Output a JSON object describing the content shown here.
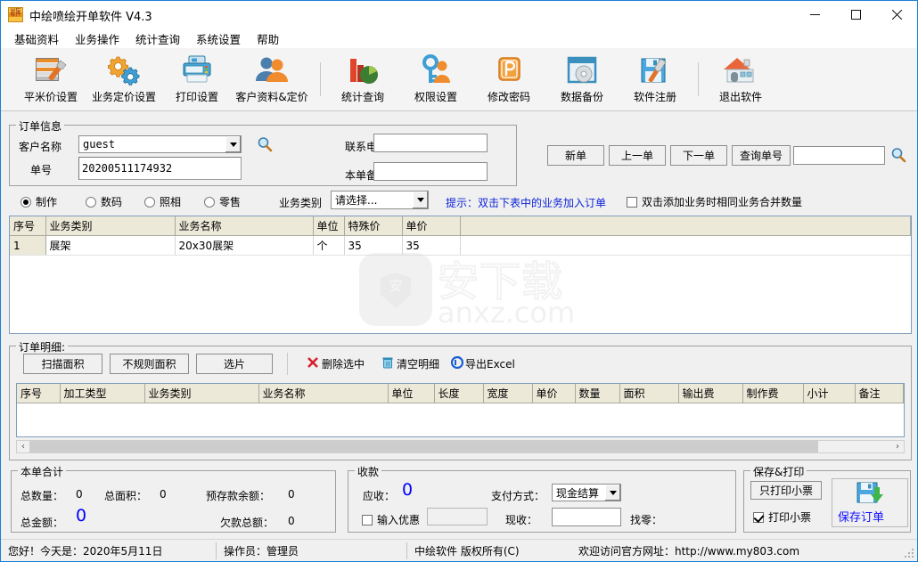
{
  "window": {
    "title": "中绘喷绘开单软件 V4.3",
    "icon": "app-icon",
    "controls": {
      "minimize": "minimize-icon",
      "maximize": "maximize-icon",
      "close": "close-icon"
    }
  },
  "menu": {
    "items": [
      "基础资料",
      "业务操作",
      "统计查询",
      "系统设置",
      "帮助"
    ]
  },
  "toolbar": {
    "items": [
      {
        "label": "平米价设置",
        "icon": "price-settings-icon"
      },
      {
        "label": "业务定价设置",
        "icon": "gears-icon"
      },
      {
        "label": "打印设置",
        "icon": "printer-icon"
      },
      {
        "label": "客户资料&定价",
        "icon": "users-icon"
      },
      {
        "label": "统计查询",
        "icon": "chart-icon"
      },
      {
        "label": "权限设置",
        "icon": "key-user-icon"
      },
      {
        "label": "修改密码",
        "icon": "password-icon"
      },
      {
        "label": "数据备份",
        "icon": "backup-disc-icon"
      },
      {
        "label": "软件注册",
        "icon": "register-floppy-icon"
      },
      {
        "label": "退出软件",
        "icon": "exit-house-icon"
      }
    ]
  },
  "order_info": {
    "legend": "订单信息",
    "customer_label": "客户名称",
    "customer_value": "guest",
    "customer_search_icon": "magnifier-icon",
    "order_no_label": "单号",
    "order_no_value": "20200511174932",
    "phone_label": "联系电话",
    "phone_value": "",
    "remark_label": "本单备注",
    "remark_value": ""
  },
  "nav": {
    "new_order": "新单",
    "prev_order": "上一单",
    "next_order": "下一单",
    "query_order": "查询单号",
    "query_value": "",
    "query_search_icon": "magnifier-icon"
  },
  "type_row": {
    "radios": [
      {
        "label": "制作",
        "checked": true
      },
      {
        "label": "数码",
        "checked": false
      },
      {
        "label": "照相",
        "checked": false
      },
      {
        "label": "零售",
        "checked": false
      }
    ],
    "category_label": "业务类别",
    "category_value": "请选择...",
    "hint": "提示：双击下表中的业务加入订单",
    "merge_checkbox": {
      "label": "双击添加业务时相同业务合并数量",
      "checked": false
    }
  },
  "biz_table": {
    "columns": [
      "序号",
      "业务类别",
      "业务名称",
      "单位",
      "特殊价",
      "单价"
    ],
    "rows": [
      {
        "序号": "1",
        "业务类别": "展架",
        "业务名称": "20x30展架",
        "单位": "个",
        "特殊价": "35",
        "单价": "35"
      }
    ]
  },
  "detail": {
    "legend": "订单明细:",
    "buttons": [
      "扫描面积",
      "不规则面积",
      "选片"
    ],
    "actions": [
      {
        "label": "删除选中",
        "icon": "delete-x-icon"
      },
      {
        "label": "清空明细",
        "icon": "trash-icon"
      },
      {
        "label": "导出Excel",
        "icon": "export-excel-icon"
      }
    ],
    "columns": [
      "序号",
      "加工类型",
      "业务类别",
      "业务名称",
      "单位",
      "长度",
      "宽度",
      "单价",
      "数量",
      "面积",
      "输出费",
      "制作费",
      "小计",
      "备注"
    ],
    "rows": [],
    "scroll_left_icon": "chevron-left-icon",
    "scroll_right_icon": "chevron-right-icon"
  },
  "totals": {
    "legend": "本单合计",
    "qty_label": "总数量：",
    "qty_value": "0",
    "area_label": "总面积：",
    "area_value": "0",
    "prepaid_label": "预存款余额：",
    "prepaid_value": "0",
    "amount_label": "总金额：",
    "amount_value": "0",
    "debt_label": "欠款总额：",
    "debt_value": "0"
  },
  "payment": {
    "legend": "收款",
    "receivable_label": "应收：",
    "receivable_value": "0",
    "method_label": "支付方式：",
    "method_value": "现金结算",
    "discount_checkbox": {
      "label": "输入优惠",
      "checked": false
    },
    "discount_value": "",
    "received_label": "现收：",
    "received_value": "",
    "change_label": "找零：",
    "change_value": ""
  },
  "save_print": {
    "legend": "保存&打印",
    "print_only_button": "只打印小票",
    "print_checkbox": {
      "label": "打印小票",
      "checked": true
    },
    "save_button": "保存订单",
    "save_icon": "save-floppy-icon"
  },
  "watermark": {
    "text": "安下载",
    "url": "anxz.com"
  },
  "status_bar": {
    "greeting": "您好！今天是：2020年5月11日",
    "operator": "操作员：管理员",
    "copyright": "中绘软件 版权所有(C)",
    "website": "欢迎访问官方网址：http://www.my803.com"
  },
  "colors": {
    "accent_blue": "#0000ff",
    "hint_blue": "#0b23d8",
    "title_border": "#1b7fd4"
  }
}
